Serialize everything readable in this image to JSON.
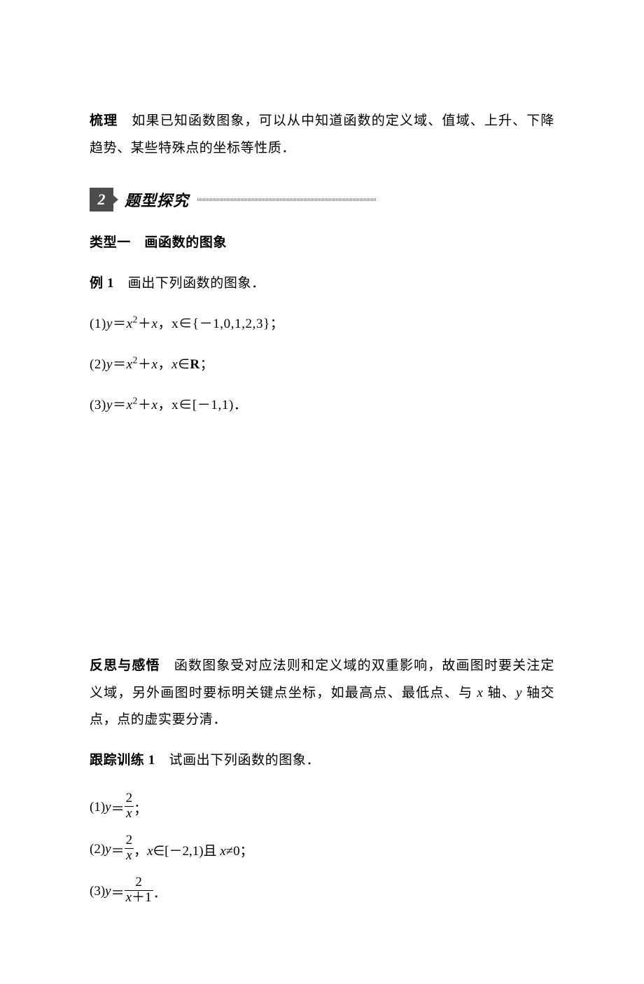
{
  "intro": {
    "bold_label": "梳理",
    "text": "　如果已知函数图象，可以从中知道函数的定义域、值域、上升、下降趋势、某些特殊点的坐标等性质．"
  },
  "section": {
    "number": "2",
    "title": "题型探究"
  },
  "type1": {
    "label": "类型一",
    "title": "　画函数的图象"
  },
  "example1": {
    "label": "例",
    "num": "1",
    "prompt": "　画出下列函数的图象．",
    "item1_lead": "(1)",
    "item1_eq_lhs": "y",
    "item1_eq_eq": "＝",
    "item1_eq_rhs1": "x",
    "item1_eq_sup": "2",
    "item1_eq_plus": "＋",
    "item1_eq_rhs2": "x",
    "item1_cond": "，x∈{－1,0,1,2,3}；",
    "item2_lead": "(2)",
    "item2_cond": "，x∈R；",
    "item3_lead": "(3)",
    "item3_cond": "，x∈[－1,1)．"
  },
  "reflect": {
    "label": "反思与感悟",
    "text": "　函数图象受对应法则和定义域的双重影响，故画图时要关注定义域，另外画图时要标明关键点坐标，如最高点、最低点、与 x 轴、y 轴交点，点的虚实要分清．"
  },
  "follow": {
    "label": "跟踪训练",
    "num": "1",
    "prompt": "　试画出下列函数的图象．",
    "i1_lead": "(1)",
    "i1_y": "y",
    "i1_eq": "＝",
    "i1_num": "2",
    "i1_den": "x",
    "i1_tail": "；",
    "i2_lead": "(2)",
    "i2_num": "2",
    "i2_den": "x",
    "i2_tail": "，x∈[－2,1)且 x≠0；",
    "i3_lead": "(3)",
    "i3_num": "2",
    "i3_den_a": "x",
    "i3_den_plus": "＋",
    "i3_den_b": "1",
    "i3_tail": "．"
  }
}
